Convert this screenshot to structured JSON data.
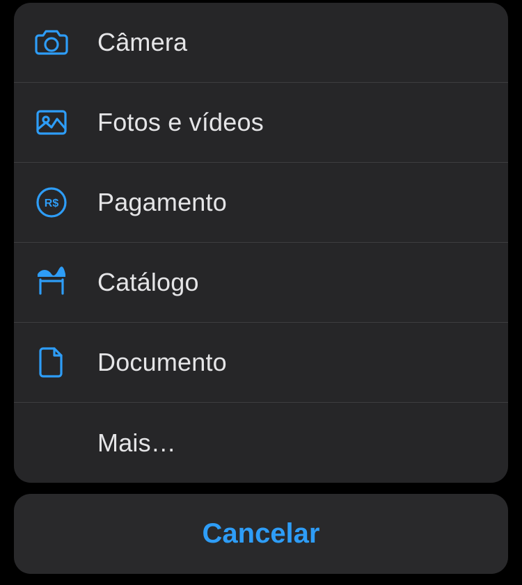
{
  "colors": {
    "accent": "#2e9df7",
    "text": "#e5e5e7",
    "sheet": "rgba(40,40,42,0.94)",
    "divider": "rgba(130,130,130,0.25)"
  },
  "sheet": {
    "items": [
      {
        "label": "Câmera",
        "icon": "camera-icon"
      },
      {
        "label": "Fotos e vídeos",
        "icon": "photo-icon"
      },
      {
        "label": "Pagamento",
        "icon": "payment-icon"
      },
      {
        "label": "Catálogo",
        "icon": "catalog-icon"
      },
      {
        "label": "Documento",
        "icon": "document-icon"
      },
      {
        "label": "Mais…",
        "icon": ""
      }
    ]
  },
  "cancel": {
    "label": "Cancelar"
  }
}
